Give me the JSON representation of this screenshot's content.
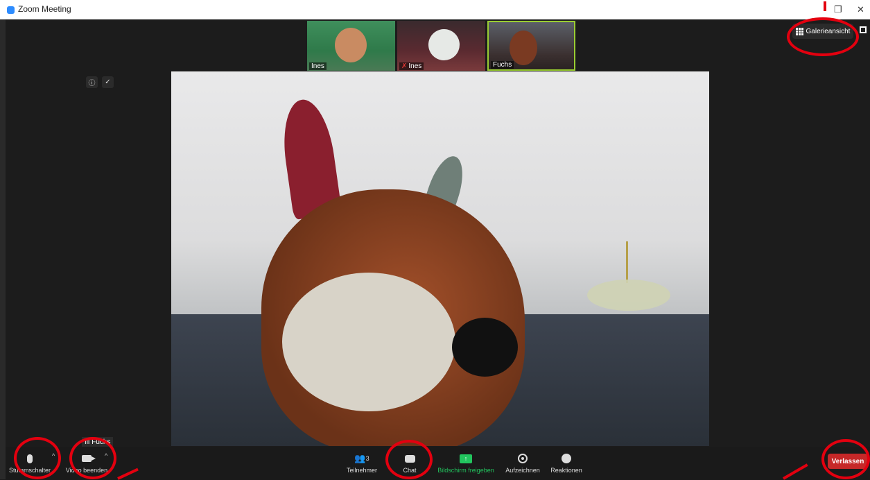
{
  "window": {
    "title": "Zoom Meeting",
    "restore_glyph": "❐",
    "close_glyph": "✕"
  },
  "thumbnails": [
    {
      "name": "Ines",
      "muted": false
    },
    {
      "name": "Ines",
      "muted": true
    },
    {
      "name": "Fuchs",
      "muted": false
    }
  ],
  "view": {
    "label": "Galerieansicht"
  },
  "active_speaker": {
    "name": "Fuchs"
  },
  "toolbar": {
    "mute_label": "Stummschalter",
    "video_label": "Video beenden",
    "participants_label": "Teilnehmer",
    "participants_count": "3",
    "chat_label": "Chat",
    "share_label": "Bildschirm freigeben",
    "record_label": "Aufzeichnen",
    "reactions_label": "Reaktionen",
    "leave_label": "Verlassen"
  },
  "colors": {
    "accent_red": "#e3000f",
    "share_green": "#22c55e",
    "leave_red": "#c62828"
  }
}
